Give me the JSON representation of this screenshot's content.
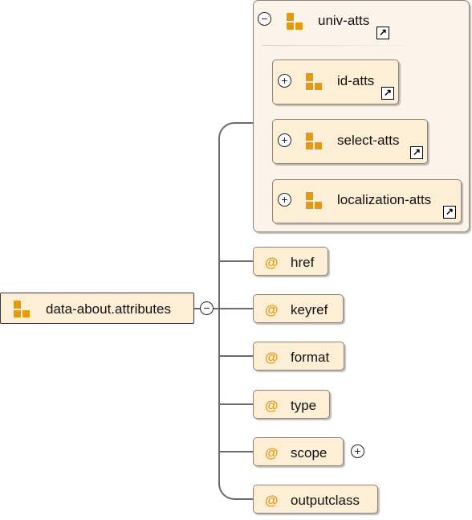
{
  "diagram": {
    "root": {
      "label": "data-about.attributes",
      "icon": "attribute-group-icon",
      "toggle": "−"
    },
    "group": {
      "label": "univ-atts",
      "icon": "attribute-group-icon",
      "toggle": "−",
      "link_icon": "↗",
      "children": [
        {
          "label": "id-atts",
          "toggle": "+",
          "icon": "attribute-group-icon",
          "link_icon": "↗"
        },
        {
          "label": "select-atts",
          "toggle": "+",
          "icon": "attribute-group-icon",
          "link_icon": "↗"
        },
        {
          "label": "localization-atts",
          "toggle": "+",
          "icon": "attribute-group-icon",
          "link_icon": "↗"
        }
      ]
    },
    "attributes": [
      {
        "symbol": "@",
        "label": "href"
      },
      {
        "symbol": "@",
        "label": "keyref"
      },
      {
        "symbol": "@",
        "label": "format"
      },
      {
        "symbol": "@",
        "label": "type"
      },
      {
        "symbol": "@",
        "label": "scope",
        "toggle": "+"
      },
      {
        "symbol": "@",
        "label": "outputclass"
      }
    ],
    "colors": {
      "node_fill": "#fdefd6",
      "group_fill": "#fbf4ea",
      "icon_orange": "#e39a10",
      "connector": "#6b6b6b"
    }
  }
}
